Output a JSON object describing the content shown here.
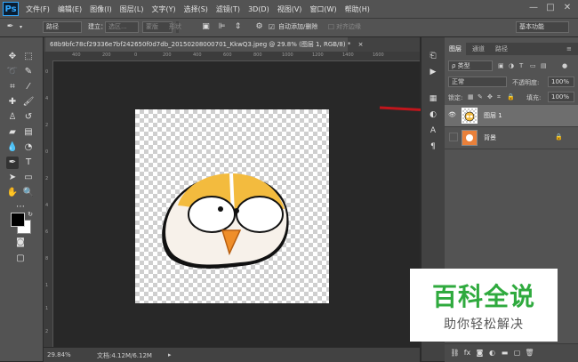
{
  "app": {
    "logo": "Ps"
  },
  "menu": [
    "文件(F)",
    "编辑(E)",
    "图像(I)",
    "图层(L)",
    "文字(Y)",
    "选择(S)",
    "滤镜(T)",
    "3D(D)",
    "视图(V)",
    "窗口(W)",
    "帮助(H)"
  ],
  "window_controls": {
    "minimize": "—",
    "maximize": "□",
    "close": "✕"
  },
  "options": {
    "mode": "路径",
    "make_label": "建立：",
    "selection_btn": "选区...",
    "mask_btn": "蒙版",
    "shape_btn": "形状",
    "auto_add_delete": "自动添加/删除",
    "align_edges": "对齐边缘",
    "workspace": "基本功能"
  },
  "document": {
    "tab_title": "68b9bfc78cf29336e7bf242650f0d7db_20150208000701_KkwQ3.jpeg @ 29.8% (图层 1, RGB/8) *",
    "tab_close": "×",
    "ruler_top": [
      "400",
      "200",
      "0",
      "200",
      "400",
      "600",
      "800",
      "1000",
      "1200",
      "1400",
      "1600"
    ],
    "ruler_left": [
      "0",
      "4",
      "2",
      "0",
      "2",
      "4",
      "6",
      "8",
      "1",
      "1",
      "2"
    ],
    "zoom": "29.84%",
    "doc_size": "文档:4.12M/6.12M"
  },
  "layers_panel": {
    "tabs": [
      "图层",
      "通道",
      "路径"
    ],
    "filter_kind": "ρ 类型",
    "blend_mode": "正常",
    "opacity_label": "不透明度:",
    "opacity_value": "100%",
    "lock_label": "锁定:",
    "fill_label": "填充:",
    "fill_value": "100%",
    "layers": [
      {
        "name": "图层 1",
        "visible": true,
        "selected": true
      },
      {
        "name": "背景",
        "visible": false,
        "selected": false,
        "locked": true
      }
    ]
  },
  "watermark": {
    "title": "百科全说",
    "subtitle": "助你轻松解决"
  },
  "colors": {
    "accent": "#31a8ff",
    "arrow": "#c0161c",
    "watermark_green": "#2faa3e"
  }
}
